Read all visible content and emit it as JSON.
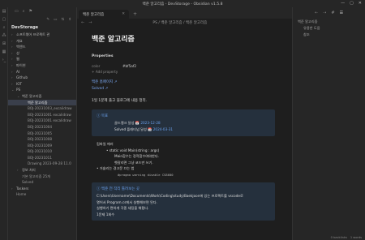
{
  "window": {
    "title": "백준 알고리즘 - DevStorage - Obsidian v1.5.8"
  },
  "ribbon": {
    "icons": [
      "files-icon",
      "search-icon",
      "graph-icon",
      "canvas-icon",
      "calendar-icon",
      "command-icon"
    ]
  },
  "sidebar": {
    "vault_name": "DevStorage",
    "tree": [
      {
        "label": "소프트웨어 프로젝트 관",
        "indent": 1,
        "kind": "folder"
      },
      {
        "label": "개요",
        "indent": 1,
        "kind": "folder"
      },
      {
        "label": "백엔드",
        "indent": 1,
        "kind": "folder"
      },
      {
        "label": "성",
        "indent": 1,
        "kind": "folder"
      },
      {
        "label": "웹",
        "indent": 1,
        "kind": "folder"
      },
      {
        "label": "파이썬",
        "indent": 1,
        "kind": "folder"
      },
      {
        "label": "AI",
        "indent": 1,
        "kind": "folder"
      },
      {
        "label": "Github",
        "indent": 1,
        "kind": "folder"
      },
      {
        "label": "IOT",
        "indent": 1,
        "kind": "folder"
      },
      {
        "label": "PS",
        "indent": 1,
        "kind": "open"
      },
      {
        "label": "백준 알고리즘",
        "indent": 2,
        "kind": "open"
      },
      {
        "label": "백준 알고리즘",
        "indent": 3,
        "kind": "active"
      },
      {
        "label": "BOJ-20231003_excalidraw",
        "indent": 3,
        "kind": "file"
      },
      {
        "label": "BOJ-20231001 excalidraw",
        "indent": 3,
        "kind": "file"
      },
      {
        "label": "BOJ-20231001 excalidraw",
        "indent": 3,
        "kind": "file"
      },
      {
        "label": "BOJ-20231004",
        "indent": 3,
        "kind": "file"
      },
      {
        "label": "BOJ-20231005",
        "indent": 3,
        "kind": "file"
      },
      {
        "label": "BOJ-20231008",
        "indent": 3,
        "kind": "file"
      },
      {
        "label": "BOJ-20231009",
        "indent": 3,
        "kind": "file"
      },
      {
        "label": "BOJ-20231010",
        "indent": 3,
        "kind": "file"
      },
      {
        "label": "BOJ-20231011",
        "indent": 3,
        "kind": "file"
      },
      {
        "label": "Drawing 2023-09-28 11.0",
        "indent": 3,
        "kind": "file"
      },
      {
        "label": "정보 처리",
        "indent": 2,
        "kind": "folder"
      },
      {
        "label": "기본 알고리즘 25개",
        "indent": 2,
        "kind": "file"
      },
      {
        "label": "Solved",
        "indent": 2,
        "kind": "file"
      },
      {
        "label": "Taskers",
        "indent": 1,
        "kind": "folder"
      },
      {
        "label": "Home",
        "indent": 1,
        "kind": "file"
      }
    ]
  },
  "editor": {
    "tab_title": "백준 알고리즘",
    "breadcrumb": "PS / 백준 알고리즘 / 백준 알고리즘",
    "title": "백준 알고리즘",
    "properties": {
      "heading": "Properties",
      "rows": [
        {
          "key": "color",
          "value": "#bf5af2"
        }
      ],
      "add_label": "+ Add property"
    },
    "links": [
      "백준 홈페이지 ↗",
      "Solved ↗"
    ],
    "intro": "1일 1문제 풀고 블로그에 내용 정리.",
    "goal_callout": {
      "title": "ⓘ 목표",
      "rows": [
        {
          "label": "골드랭크 달성 📅 ",
          "date": "2023-12-28"
        },
        {
          "label": "Solved 플래티넘 달성 📅 ",
          "date": "2024-03-31"
        }
      ]
    },
    "compile_list": [
      {
        "text": "컴파일 에러",
        "level": "l1"
      },
      {
        "text": "• static void Main(string : args)",
        "level": "l2"
      },
      {
        "text": "Main함수는 정적함수여야한다.",
        "level": "l3"
      },
      {
        "text": "헷갈리면 그냥 코드만 쓰기.",
        "level": "l3"
      },
      {
        "text": "• 거슬리는 경고문 끄는 법",
        "level": "l1"
      },
      {
        "text": "#pragma warning disable CS8600",
        "level": "code"
      }
    ],
    "path_callout": {
      "title": "ⓘ 백준 전 작리 틀려보는 곳",
      "lines": [
        "C:\\Users\\Username\\Documents\\Work\\Coding\\study\\Baekjoon에 있는 프로젝트를 vscode로",
        "열어서 Program.cs에서 실행해보면 된다.",
        "실행하기 편하게 각종 세팅을 해뒀다.",
        "1문제 1회수"
      ]
    }
  },
  "right_panel": {
    "outline": [
      {
        "text": "백준 알고리즘",
        "indent": 0
      },
      {
        "text": "유용한 도움",
        "indent": 1
      },
      {
        "text": "참조",
        "indent": 1
      }
    ]
  },
  "status": {
    "backlinks": "0 backlinks",
    "words": "1 words"
  }
}
